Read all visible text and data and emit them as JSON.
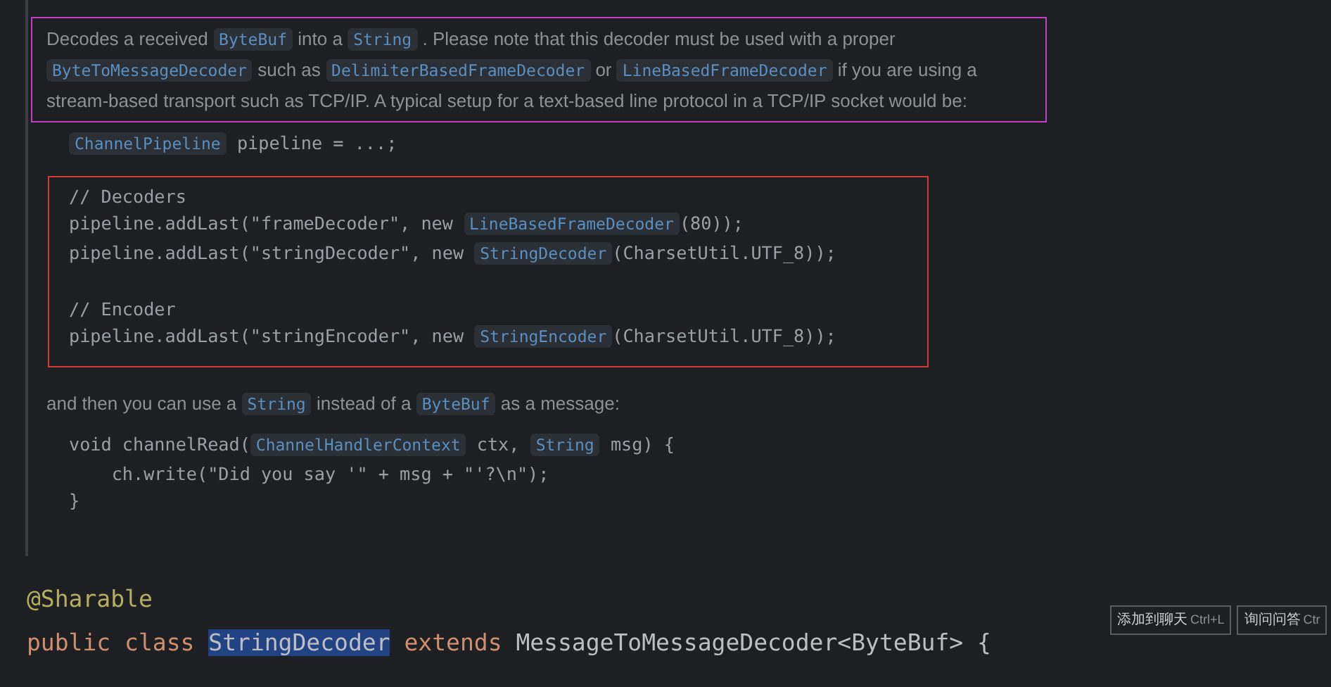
{
  "doc": {
    "intro": [
      {
        "text": "Decodes a received",
        "code": false
      },
      {
        "text": "ByteBuf",
        "code": true
      },
      {
        "text": "into a",
        "code": false
      },
      {
        "text": "String",
        "code": true
      },
      {
        "text": ". Please note that this decoder must be used with a proper",
        "code": false
      },
      {
        "text": "ByteToMessageDecoder",
        "code": true
      },
      {
        "text": "such as",
        "code": false
      },
      {
        "text": "DelimiterBasedFrameDecoder",
        "code": true
      },
      {
        "text": "or",
        "code": false
      },
      {
        "text": "LineBasedFrameDecoder",
        "code": true
      },
      {
        "text": "if you are using a stream-based transport such as TCP/IP. A typical setup for a text-based line protocol in a TCP/IP socket would be:",
        "code": false
      }
    ],
    "pipeline_line": [
      {
        "text": "ChannelPipeline",
        "code": true
      },
      {
        "text": " pipeline = ...;",
        "code": false
      }
    ],
    "code_block": [
      [
        [
          {
            "text": "// Decoders",
            "code": false
          }
        ],
        [
          {
            "text": "pipeline.addLast(\"frameDecoder\", new ",
            "code": false
          },
          {
            "text": "LineBasedFrameDecoder",
            "code": true
          },
          {
            "text": "(80));",
            "code": false
          }
        ],
        [
          {
            "text": "pipeline.addLast(\"stringDecoder\", new ",
            "code": false
          },
          {
            "text": "StringDecoder",
            "code": true
          },
          {
            "text": "(CharsetUtil.UTF_8));",
            "code": false
          }
        ]
      ],
      [
        [
          {
            "text": "// Encoder",
            "code": false
          }
        ],
        [
          {
            "text": "pipeline.addLast(\"stringEncoder\", new ",
            "code": false
          },
          {
            "text": "StringEncoder",
            "code": true
          },
          {
            "text": "(CharsetUtil.UTF_8));",
            "code": false
          }
        ]
      ]
    ],
    "outro": [
      {
        "text": "and then you can use a",
        "code": false
      },
      {
        "text": "String",
        "code": true
      },
      {
        "text": "instead of a",
        "code": false
      },
      {
        "text": "ByteBuf",
        "code": true
      },
      {
        "text": "as a message:",
        "code": false
      }
    ],
    "example_lines": [
      [
        {
          "text": "void channelRead(",
          "code": false
        },
        {
          "text": "ChannelHandlerContext",
          "code": true
        },
        {
          "text": " ctx, ",
          "code": false
        },
        {
          "text": "String",
          "code": true
        },
        {
          "text": " msg) {",
          "code": false
        }
      ],
      [
        {
          "text": "    ch.write(\"Did you say '\" + msg + \"'?\\n\");",
          "code": false
        }
      ],
      [
        {
          "text": "}",
          "code": false
        }
      ]
    ]
  },
  "source": {
    "annotation": "@Sharable",
    "declaration": [
      {
        "text": "public class ",
        "kind": "keyword"
      },
      {
        "text": "StringDecoder",
        "kind": "selected"
      },
      {
        "text": " extends ",
        "kind": "keyword"
      },
      {
        "text": "MessageToMessageDecoder<ByteBuf> {",
        "kind": "plain"
      }
    ]
  },
  "popup_buttons": [
    {
      "label": "添加到聊天",
      "shortcut": "Ctrl+L"
    },
    {
      "label": "询问问答",
      "shortcut": "Ctr"
    }
  ]
}
